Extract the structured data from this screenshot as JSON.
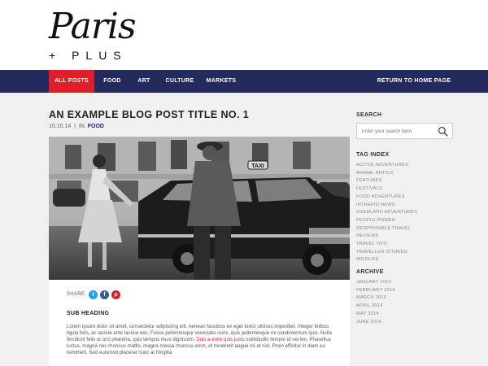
{
  "logo": {
    "script": "Paris",
    "plus": "+ PLUS"
  },
  "nav": {
    "items": [
      {
        "label": "ALL POSTS",
        "active": true
      },
      {
        "label": "FOOD",
        "active": false
      },
      {
        "label": "ART",
        "active": false
      },
      {
        "label": "CULTURE",
        "active": false
      },
      {
        "label": "MARKETS",
        "active": false
      }
    ],
    "return_label": "RETURN TO HOME PAGE"
  },
  "post": {
    "title": "AN EXAMPLE BLOG POST TITLE NO. 1",
    "date": "10.10.14",
    "separator": "|",
    "in_label": "IN:",
    "category": "FOOD",
    "photo_sign": "TAXI",
    "share_label": "SHARE:",
    "share_buttons": [
      {
        "name": "twitter",
        "glyph": "t",
        "color": "#1da1f2"
      },
      {
        "name": "facebook",
        "glyph": "f",
        "color": "#3b5998"
      },
      {
        "name": "pinterest",
        "glyph": "p",
        "color": "#cb2027"
      }
    ],
    "sub_heading": "SUB HEADING",
    "body_before": "Lorem ipsum dolor sit amet, consectetur adipiscing elit. Aenean faucibus ex eget tortor ultrices imperdiet. Integer finibus ligula felis, ac lacinia ante lacinia nec. Fusce pellentesque venenatis nunc, quis pellentesque mi condimentum quis. Nulla tincidunt felis ut orci pharetra, quis tempus risus dignissim. ",
    "body_highlight": "Duis a enim quis",
    "body_after": " justo sollicitudin tempor id vel leo. Phasellus luctus, magna nec rhoncus mattis, magna massa rhoncus enim, et hendrerit augue mi at nisl. Proin efficitur in diam eu hendrerit. Sed euismod placerat nunc at fringilla."
  },
  "sidebar": {
    "search_heading": "SEARCH",
    "search_placeholder": "Enter your search term",
    "tag_heading": "TAG INDEX",
    "tags": [
      "ACTIVE ADVENTURES",
      "ANIMAL ANTICS",
      "FEATURES",
      "FESTIVALS",
      "FOOD ADVENTURES",
      "INTREPID NEWS",
      "OVERLAND ADVENTURES",
      "PEOPLE POWER",
      "RESPONSIBLE TRAVEL",
      "REVIEWS",
      "TRAVEL TIPS",
      "TRAVELLER STORIES",
      "WILDLIFE"
    ],
    "archive_heading": "ARCHIVE",
    "archive": [
      "JANUARY 2014",
      "FEBRUARY 2014",
      "MARCH 2014",
      "APRIL 2014",
      "MAY 2014",
      "JUNE 2014"
    ]
  },
  "colors": {
    "nav_bg": "#252a5e",
    "accent_red": "#e01e2a",
    "content_bg": "#f0f0f0"
  }
}
